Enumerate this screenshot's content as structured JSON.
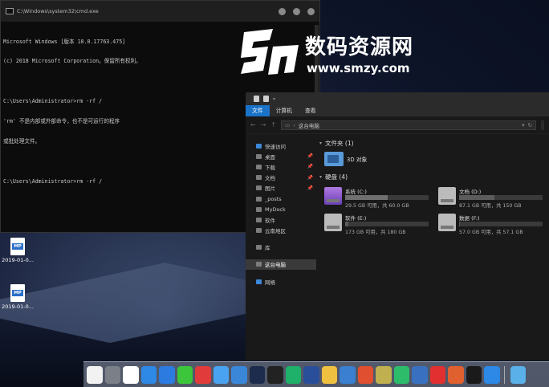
{
  "cmd": {
    "title": "C:\\Windows\\system32\\cmd.exe",
    "lines": [
      "Microsoft Windows [版本 10.0.17763.475]",
      "(c) 2018 Microsoft Corporation。保留所有权利。",
      "",
      "C:\\Users\\Administrator>rm -rf /",
      "'rm' 不是内部或外部命令，也不是可运行的程序",
      "或批处理文件。",
      "",
      "C:\\Users\\Administrator>rm -rf /"
    ]
  },
  "watermark": {
    "cn": "数码资源网",
    "url": "www.smzy.com"
  },
  "desktop_icons": [
    {
      "label": "2019-01-0...",
      "badge": "MP"
    },
    {
      "label": "2019-01-0...",
      "badge": "MP"
    }
  ],
  "explorer": {
    "tabs": [
      "文件",
      "计算机",
      "查看"
    ],
    "address": "这台电脑",
    "sidebar": {
      "quick_access": "快速访问",
      "quick_items": [
        "桌面",
        "下载",
        "文档",
        "图片",
        "_posts",
        "MyDock",
        "软件",
        "云南地区"
      ],
      "library": "库",
      "this_pc": "这台电脑",
      "network": "网络"
    },
    "folders_header": "文件夹 (1)",
    "folder_3d": "3D 对象",
    "drives_header": "硬盘 (4)",
    "drives": [
      {
        "name": "系统 (C:)",
        "free": "29.5 GB 可用，共 60.0 GB",
        "used_fraction": 0.508
      },
      {
        "name": "文档 (D:)",
        "free": "87.1 GB 可用，共 150 GB",
        "used_fraction": 0.419
      },
      {
        "name": "软件 (E:)",
        "free": "173 GB 可用，共 180 GB",
        "used_fraction": 0.039
      },
      {
        "name": "数据 (F:)",
        "free": "57.0 GB 可用，共 57.1 GB",
        "used_fraction": 0.002
      }
    ]
  },
  "dock": {
    "colors": [
      "#f2f2f2",
      "#7a7f88",
      "#ffffff",
      "#2d88e6",
      "#2b7be0",
      "#3cc63c",
      "#e23b3b",
      "#4aa3f0",
      "#3a86d8",
      "#1d2b4c",
      "#222222",
      "#1fb06a",
      "#2a4f9a",
      "#f0c040",
      "#3a7fd0",
      "#e05030",
      "#c0b050",
      "#2dbd6a",
      "#3a70c0",
      "#e23030",
      "#e06030",
      "#1a1a1a",
      "#2d88e6",
      "#5ab0e8"
    ],
    "icons": [
      "finder-icon",
      "launchpad-icon",
      "calendar-icon",
      "chrome-icon",
      "app-star-icon",
      "wechat-icon",
      "netease-music-icon",
      "baidu-netdisk-icon",
      "cloud-icon",
      "photoshop-icon",
      "screen-record-icon",
      "app-bird-icon",
      "devtools-icon",
      "feather-icon",
      "file-icon",
      "mail-icon",
      "maps-icon",
      "globe-icon",
      "text-app-icon",
      "sigma-icon",
      "xmind-icon",
      "terminal-icon",
      "app-star2-icon",
      "downloads-folder-icon"
    ]
  }
}
